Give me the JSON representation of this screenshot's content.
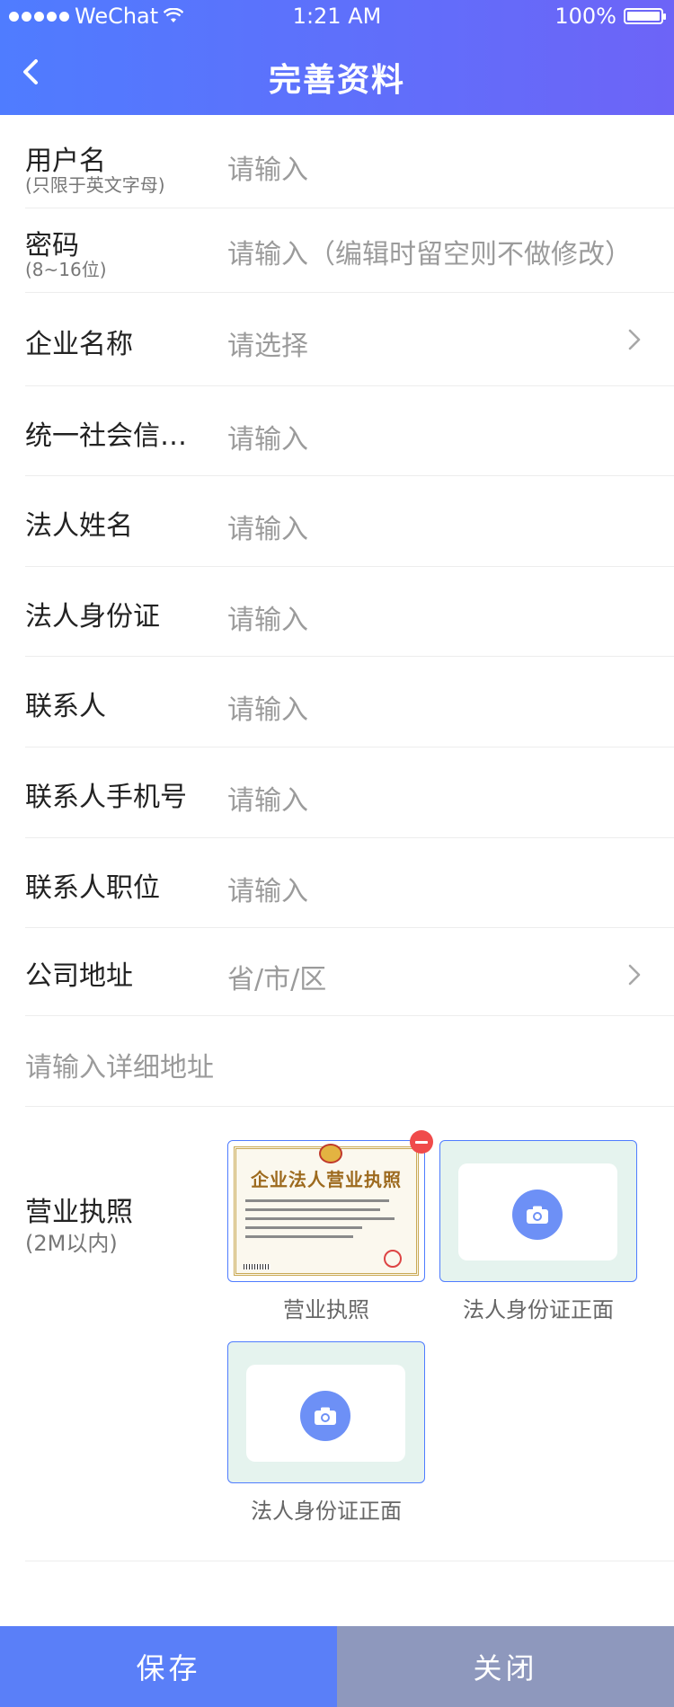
{
  "status_bar": {
    "carrier": "WeChat",
    "time": "1:21 AM",
    "battery": "100%"
  },
  "nav": {
    "title": "完善资料"
  },
  "form": {
    "username": {
      "label": "用户名",
      "hint": "(只限于英文字母)",
      "placeholder": "请输入"
    },
    "password": {
      "label": "密码",
      "hint": "(8~16位)",
      "placeholder": "请输入（编辑时留空则不做修改）"
    },
    "company": {
      "label": "企业名称",
      "placeholder": "请选择"
    },
    "credit_code": {
      "label": "统一社会信用代码",
      "placeholder": "请输入"
    },
    "legal_name": {
      "label": "法人姓名",
      "placeholder": "请输入"
    },
    "legal_id": {
      "label": "法人身份证",
      "placeholder": "请输入"
    },
    "contact": {
      "label": "联系人",
      "placeholder": "请输入"
    },
    "contact_phone": {
      "label": "联系人手机号",
      "placeholder": "请输入"
    },
    "contact_title": {
      "label": "联系人职位",
      "placeholder": "请输入"
    },
    "address": {
      "label": "公司地址",
      "placeholder": "省/市/区"
    },
    "address_detail": {
      "placeholder": "请输入详细地址"
    },
    "license": {
      "label": "营业执照",
      "hint": "(2M以内)",
      "image_title": "企业法人营业执照",
      "uploads": [
        {
          "caption": "营业执照",
          "state": "uploaded"
        },
        {
          "caption": "法人身份证正面",
          "state": "empty"
        },
        {
          "caption": "法人身份证正面",
          "state": "empty"
        }
      ]
    }
  },
  "footer": {
    "save": "保存",
    "close": "关闭"
  },
  "colors": {
    "header_start": "#4f7cff",
    "header_end": "#6d64f7",
    "save": "#5a7ff8",
    "close": "#8e98bd",
    "remove": "#f04b4b"
  }
}
